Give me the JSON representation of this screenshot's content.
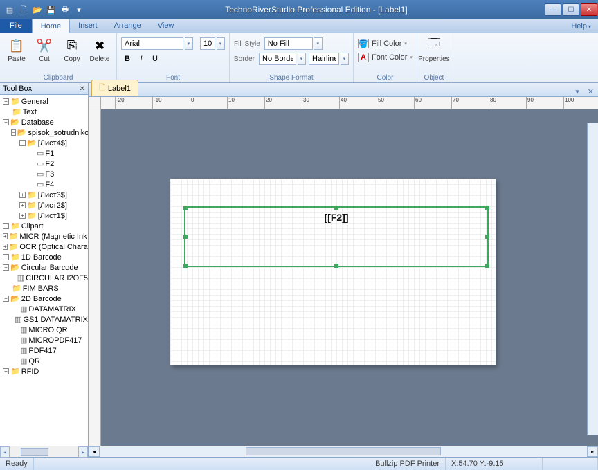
{
  "titlebar": {
    "title": "TechnoRiverStudio Professional Edition - [Label1]"
  },
  "tabs": {
    "file": "File",
    "home": "Home",
    "insert": "Insert",
    "arrange": "Arrange",
    "view": "View",
    "help": "Help"
  },
  "ribbon": {
    "clipboard": {
      "paste": "Paste",
      "cut": "Cut",
      "copy": "Copy",
      "delete": "Delete",
      "label": "Clipboard"
    },
    "font": {
      "family": "Arial",
      "size": "10",
      "label": "Font"
    },
    "shape": {
      "fillstyle_label": "Fill Style",
      "fillstyle_value": "No Fill",
      "border_label": "Border",
      "border_value": "No Border",
      "hairline": "Hairline",
      "label": "Shape Format"
    },
    "color": {
      "fill": "Fill Color",
      "font": "Font Color",
      "label": "Color"
    },
    "object": {
      "properties": "Properties",
      "label": "Object"
    }
  },
  "toolbox": {
    "title": "Tool Box",
    "nodes": {
      "general": "General",
      "text": "Text",
      "database": "Database",
      "spisok": "spisok_sotrudnikov.xls",
      "list4": "[Лист4$]",
      "f1": "F1",
      "f2": "F2",
      "f3": "F3",
      "f4": "F4",
      "list3": "[Лист3$]",
      "list2": "[Лист2$]",
      "list1": "[Лист1$]",
      "clipart": "Clipart",
      "micr": "MICR (Magnetic Ink Charact",
      "ocr": "OCR (Optical Character Rec",
      "barcode1d": "1D Barcode",
      "circular": "Circular Barcode",
      "circ12of5": "CIRCULAR I2OF5",
      "fimbars": "FIM BARS",
      "barcode2d": "2D Barcode",
      "datamatrix": "DATAMATRIX",
      "gs1": "GS1 DATAMATRIX",
      "microqr": "MICRO QR",
      "micropdf": "MICROPDF417",
      "pdf417": "PDF417",
      "qr": "QR",
      "rfid": "RFID"
    }
  },
  "document": {
    "tab": "Label1",
    "selection_text": "[[F2]]"
  },
  "status": {
    "ready": "Ready",
    "printer": "Bullzip PDF Printer",
    "coords": "X:54.70   Y:-9.15"
  },
  "ruler_ticks": [
    "-20",
    "-10",
    "0",
    "10",
    "20",
    "30",
    "40",
    "50",
    "60",
    "70",
    "80",
    "90",
    "100"
  ]
}
